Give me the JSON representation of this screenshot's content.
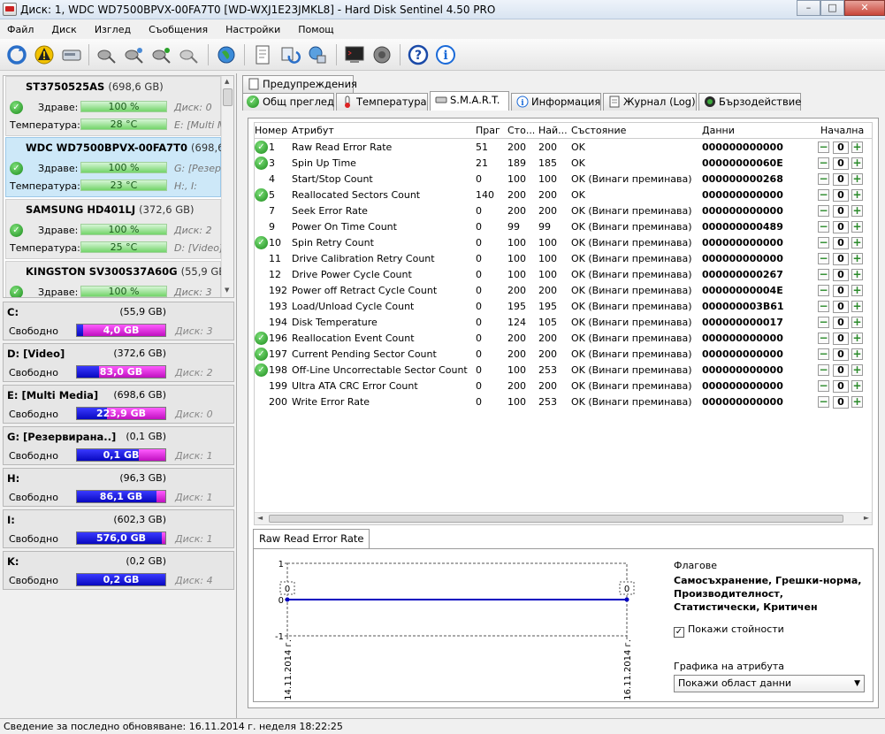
{
  "window": {
    "title": "Диск: 1, WDC WD7500BPVX-00FA7T0 [WD-WXJ1E23JMKL8]  -  Hard Disk Sentinel 4.50 PRO"
  },
  "menu": [
    "Файл",
    "Диск",
    "Изглед",
    "Съобщения",
    "Настройки",
    "Помощ"
  ],
  "toolbar_icons": [
    "refresh-icon",
    "warning-icon",
    "disk-icon",
    "probe-icon",
    "probe-refresh-icon",
    "probe-check-icon",
    "probe-clear-icon",
    "globe-icon",
    "report-icon",
    "sync-icon",
    "network-icon",
    "terminal-icon",
    "speaker-icon",
    "help-icon",
    "info-icon"
  ],
  "disks": [
    {
      "name": "ST3750525AS",
      "size": "(698,6 GB)",
      "health_label": "Здраве:",
      "health": "100 %",
      "disk_ref": "Диск: 0",
      "temp_label": "Температура:",
      "temp": "28 °C",
      "vols": "E: [Multi M"
    },
    {
      "name": "WDC WD7500BPVX-00FA7T0",
      "size": "(698,6 GB)",
      "health_label": "Здраве:",
      "health": "100 %",
      "disk_ref": "G: [Резерв",
      "temp_label": "Температура:",
      "temp": "23 °C",
      "vols": "H:, I:"
    },
    {
      "name": "SAMSUNG HD401LJ",
      "size": "(372,6 GB)",
      "health_label": "Здраве:",
      "health": "100 %",
      "disk_ref": "Диск: 2",
      "temp_label": "Температура:",
      "temp": "25 °C",
      "vols": "D: [Video]"
    },
    {
      "name": "KINGSTON SV300S37A60G",
      "size": "(55,9 GB)",
      "health_label": "Здраве:",
      "health": "100 %",
      "disk_ref": "Диск: 3"
    }
  ],
  "volumes": [
    {
      "name": "C:",
      "size": "(55,9 GB)",
      "free_label": "Свободно",
      "free": "4,0 GB",
      "disk": "Диск: 3",
      "fill": 0.93,
      "color": "#1010e0"
    },
    {
      "name": "D: [Video]",
      "size": "(372,6 GB)",
      "free_label": "Свободно",
      "free": "83,0 GB",
      "disk": "Диск: 2",
      "fill": 0.75,
      "color": "#1010e0"
    },
    {
      "name": "E: [Multi Media]",
      "size": "(698,6 GB)",
      "free_label": "Свободно",
      "free": "223,9 GB",
      "disk": "Диск: 0",
      "fill": 0.66,
      "color": "#1010e0"
    },
    {
      "name": "G: [Резервирана..]",
      "size": "(0,1 GB)",
      "free_label": "Свободно",
      "free": "0,1 GB",
      "disk": "Диск: 1",
      "fill": 0.3,
      "color": "#1010e0"
    },
    {
      "name": "H:",
      "size": "(96,3 GB)",
      "free_label": "Свободно",
      "free": "86,1 GB",
      "disk": "Диск: 1",
      "fill": 0.1,
      "color": "#1010e0"
    },
    {
      "name": "I:",
      "size": "(602,3 GB)",
      "free_label": "Свободно",
      "free": "576,0 GB",
      "disk": "Диск: 1",
      "fill": 0.04,
      "color": "#1010e0"
    },
    {
      "name": "K:",
      "size": "(0,2 GB)",
      "free_label": "Свободно",
      "free": "0,2 GB",
      "disk": "Диск: 4",
      "fill": 0.0,
      "color": "#1010e0"
    }
  ],
  "tabs": {
    "warnings": "Предупреждения",
    "overview": "Общ преглед",
    "temperature": "Температура",
    "smart": "S.M.A.R.T.",
    "info": "Информация",
    "log": "Журнал (Log)",
    "perf": "Бързодействие"
  },
  "smart": {
    "headers": [
      "Номер",
      "Атрибут",
      "Праг",
      "Сто...",
      "Най...",
      "Състояние",
      "Данни",
      "Начална"
    ],
    "rows": [
      {
        "ok": true,
        "num": "1",
        "attr": "Raw Read Error Rate",
        "thr": "51",
        "val": "200",
        "worst": "200",
        "status": "OK",
        "data": "000000000000",
        "base": "0"
      },
      {
        "ok": true,
        "num": "3",
        "attr": "Spin Up Time",
        "thr": "21",
        "val": "189",
        "worst": "185",
        "status": "OK",
        "data": "00000000060E",
        "base": "0"
      },
      {
        "ok": false,
        "num": "4",
        "attr": "Start/Stop Count",
        "thr": "0",
        "val": "100",
        "worst": "100",
        "status": "OK (Винаги преминава)",
        "data": "000000000268",
        "base": "0"
      },
      {
        "ok": true,
        "num": "5",
        "attr": "Reallocated Sectors Count",
        "thr": "140",
        "val": "200",
        "worst": "200",
        "status": "OK",
        "data": "000000000000",
        "base": "0"
      },
      {
        "ok": false,
        "num": "7",
        "attr": "Seek Error Rate",
        "thr": "0",
        "val": "200",
        "worst": "200",
        "status": "OK (Винаги преминава)",
        "data": "000000000000",
        "base": "0"
      },
      {
        "ok": false,
        "num": "9",
        "attr": "Power On Time Count",
        "thr": "0",
        "val": "99",
        "worst": "99",
        "status": "OK (Винаги преминава)",
        "data": "000000000489",
        "base": "0"
      },
      {
        "ok": true,
        "num": "10",
        "attr": "Spin Retry Count",
        "thr": "0",
        "val": "100",
        "worst": "100",
        "status": "OK (Винаги преминава)",
        "data": "000000000000",
        "base": "0"
      },
      {
        "ok": false,
        "num": "11",
        "attr": "Drive Calibration Retry Count",
        "thr": "0",
        "val": "100",
        "worst": "100",
        "status": "OK (Винаги преминава)",
        "data": "000000000000",
        "base": "0"
      },
      {
        "ok": false,
        "num": "12",
        "attr": "Drive Power Cycle Count",
        "thr": "0",
        "val": "100",
        "worst": "100",
        "status": "OK (Винаги преминава)",
        "data": "000000000267",
        "base": "0"
      },
      {
        "ok": false,
        "num": "192",
        "attr": "Power off Retract Cycle Count",
        "thr": "0",
        "val": "200",
        "worst": "200",
        "status": "OK (Винаги преминава)",
        "data": "00000000004E",
        "base": "0"
      },
      {
        "ok": false,
        "num": "193",
        "attr": "Load/Unload Cycle Count",
        "thr": "0",
        "val": "195",
        "worst": "195",
        "status": "OK (Винаги преминава)",
        "data": "000000003B61",
        "base": "0"
      },
      {
        "ok": false,
        "num": "194",
        "attr": "Disk Temperature",
        "thr": "0",
        "val": "124",
        "worst": "105",
        "status": "OK (Винаги преминава)",
        "data": "000000000017",
        "base": "0"
      },
      {
        "ok": true,
        "num": "196",
        "attr": "Reallocation Event Count",
        "thr": "0",
        "val": "200",
        "worst": "200",
        "status": "OK (Винаги преминава)",
        "data": "000000000000",
        "base": "0"
      },
      {
        "ok": true,
        "num": "197",
        "attr": "Current Pending Sector Count",
        "thr": "0",
        "val": "200",
        "worst": "200",
        "status": "OK (Винаги преминава)",
        "data": "000000000000",
        "base": "0"
      },
      {
        "ok": true,
        "num": "198",
        "attr": "Off-Line Uncorrectable Sector Count",
        "thr": "0",
        "val": "100",
        "worst": "253",
        "status": "OK (Винаги преминава)",
        "data": "000000000000",
        "base": "0"
      },
      {
        "ok": false,
        "num": "199",
        "attr": "Ultra ATA CRC Error Count",
        "thr": "0",
        "val": "200",
        "worst": "200",
        "status": "OK (Винаги преминава)",
        "data": "000000000000",
        "base": "0"
      },
      {
        "ok": false,
        "num": "200",
        "attr": "Write Error Rate",
        "thr": "0",
        "val": "100",
        "worst": "253",
        "status": "OK (Винаги преминава)",
        "data": "000000000000",
        "base": "0"
      }
    ]
  },
  "graph": {
    "tab_label": "Raw Read Error Rate",
    "flags_title": "Флагове",
    "flags_text": "Самосъхранение, Грешки-норма, Производителност, Статистически, Критичен",
    "show_values_label": "Покажи стойности",
    "show_values_checked": true,
    "attr_graph_label": "Графика на атрибута",
    "attr_graph_select": "Покажи област данни"
  },
  "chart_data": {
    "type": "line",
    "series": [
      {
        "values": [
          0,
          0
        ]
      }
    ],
    "x": [
      "14.11.2014 г.",
      "16.11.2014 г."
    ],
    "ylim": [
      -1,
      1
    ],
    "yticks": [
      "1",
      "0",
      "-1"
    ],
    "data_labels": [
      "0",
      "0"
    ],
    "grid": true
  },
  "status": {
    "text": "Сведение за последно обновяване: 16.11.2014 г. неделя 18:22:25"
  },
  "colors": {
    "ok_green": "#1a8a1a",
    "health_green": "#74d46a",
    "free_blue": "#1010e0",
    "used_magenta": "#e020e0",
    "line_blue": "#0000c0"
  }
}
